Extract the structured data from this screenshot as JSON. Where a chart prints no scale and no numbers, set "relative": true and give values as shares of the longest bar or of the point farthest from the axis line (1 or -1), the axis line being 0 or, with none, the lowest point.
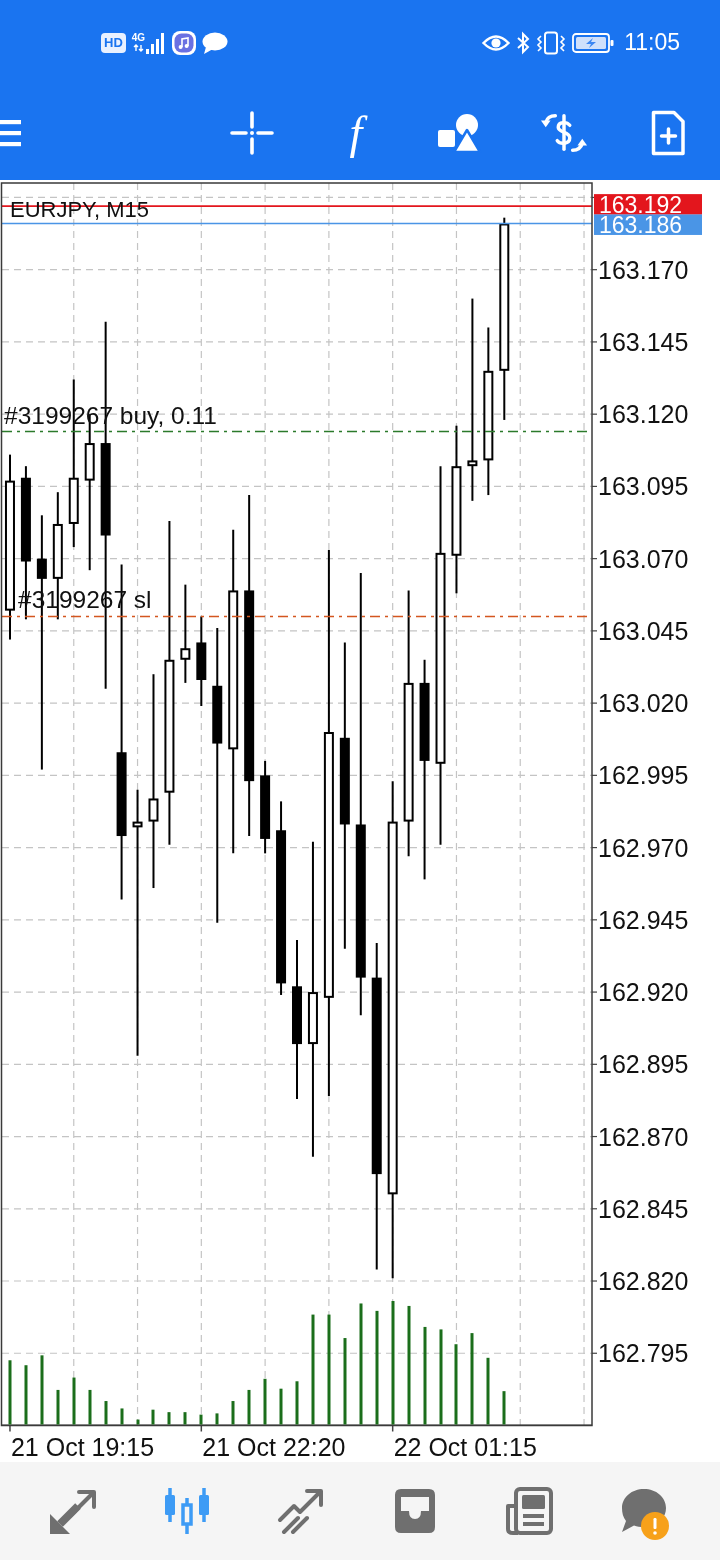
{
  "status_bar": {
    "hd_label": "HD",
    "network_type": "4G",
    "time": "11:05"
  },
  "toolbar": {
    "function_symbol": "f"
  },
  "chart": {
    "chart_data": {
      "type": "candlestick",
      "title": "EURJPY, M15",
      "grid": true,
      "categories": [
        null,
        null,
        null,
        null,
        null,
        null,
        null,
        null,
        null,
        null,
        null,
        null,
        null,
        null,
        null,
        null,
        null,
        null,
        null,
        null,
        null,
        null,
        null,
        null,
        null,
        null,
        null,
        null,
        null,
        null,
        null,
        null,
        null,
        null,
        null,
        null,
        null
      ],
      "ylim": [
        162.77,
        163.2
      ],
      "yticks": [
        {
          "value": 163.17,
          "label": "163.170"
        },
        {
          "value": 163.145,
          "label": "163.145"
        },
        {
          "value": 163.12,
          "label": "163.120"
        },
        {
          "value": 163.095,
          "label": "163.095"
        },
        {
          "value": 163.07,
          "label": "163.070"
        },
        {
          "value": 163.045,
          "label": "163.045"
        },
        {
          "value": 163.02,
          "label": "163.020"
        },
        {
          "value": 162.995,
          "label": "162.995"
        },
        {
          "value": 162.97,
          "label": "162.970"
        },
        {
          "value": 162.945,
          "label": "162.945"
        },
        {
          "value": 162.92,
          "label": "162.920"
        },
        {
          "value": 162.895,
          "label": "162.895"
        },
        {
          "value": 162.87,
          "label": "162.870"
        },
        {
          "value": 162.845,
          "label": "162.845"
        },
        {
          "value": 162.82,
          "label": "162.820"
        },
        {
          "value": 162.795,
          "label": "162.795"
        }
      ],
      "ohlc": [
        [
          163.052,
          163.106,
          163.042,
          163.097
        ],
        [
          163.098,
          163.102,
          163.049,
          163.069
        ],
        [
          163.07,
          163.085,
          162.997,
          163.063
        ],
        [
          163.063,
          163.093,
          163.049,
          163.082
        ],
        [
          163.082,
          163.132,
          163.074,
          163.098
        ],
        [
          163.097,
          163.12,
          163.066,
          163.11
        ],
        [
          163.11,
          163.152,
          163.025,
          163.078
        ],
        [
          163.003,
          163.068,
          162.952,
          162.974
        ],
        [
          162.977,
          162.99,
          162.898,
          162.979
        ],
        [
          162.979,
          163.03,
          162.956,
          162.987
        ],
        [
          162.989,
          163.083,
          162.971,
          163.035
        ],
        [
          163.035,
          163.061,
          163.027,
          163.039
        ],
        [
          163.041,
          163.05,
          163.019,
          163.028
        ],
        [
          163.026,
          163.046,
          162.944,
          163.006
        ],
        [
          163.004,
          163.08,
          162.968,
          163.059
        ],
        [
          163.059,
          163.092,
          162.974,
          162.993
        ],
        [
          162.995,
          163.0,
          162.968,
          162.973
        ],
        [
          162.976,
          162.986,
          162.919,
          162.923
        ],
        [
          162.922,
          162.938,
          162.883,
          162.902
        ],
        [
          162.902,
          162.972,
          162.863,
          162.92
        ],
        [
          162.918,
          163.073,
          162.884,
          163.01
        ],
        [
          163.008,
          163.041,
          162.935,
          162.978
        ],
        [
          162.978,
          163.065,
          162.912,
          162.925
        ],
        [
          162.925,
          162.937,
          162.824,
          162.857
        ],
        [
          162.85,
          162.993,
          162.821,
          162.979
        ],
        [
          162.979,
          163.059,
          162.967,
          163.027
        ],
        [
          163.027,
          163.035,
          162.959,
          163.0
        ],
        [
          162.999,
          163.102,
          162.971,
          163.072
        ],
        [
          163.071,
          163.116,
          163.058,
          163.102
        ],
        [
          163.102,
          163.16,
          163.09,
          163.104
        ],
        [
          163.104,
          163.15,
          163.092,
          163.135
        ],
        [
          163.135,
          163.188,
          163.118,
          163.186
        ],
        null,
        null,
        null,
        null,
        null
      ],
      "ref_lines": [
        {
          "axis": "y",
          "value": 163.192,
          "label": "163.192",
          "color": "#e3161d"
        },
        {
          "axis": "y",
          "value": 163.186,
          "label": "163.186",
          "color": "#4a95e6"
        },
        {
          "axis": "y",
          "value": 163.114,
          "label": "#3199267 buy, 0.11",
          "color": "#2b7a2b"
        },
        {
          "axis": "y",
          "value": 163.05,
          "label": "#3199267 sl",
          "color": "#d4561f"
        }
      ]
    },
    "time_axis_labels": [
      "21 Oct 19:15",
      "21 Oct 22:20",
      "22 Oct 01:15"
    ],
    "volume": {
      "chart_data": {
        "type": "bar",
        "relative": true,
        "categories": [
          null,
          null,
          null,
          null,
          null,
          null,
          null,
          null,
          null,
          null,
          null,
          null,
          null,
          null,
          null,
          null,
          null,
          null,
          null,
          null,
          null,
          null,
          null,
          null,
          null,
          null,
          null,
          null,
          null,
          null,
          null,
          null,
          null,
          null,
          null,
          null,
          null
        ],
        "values": [
          0.52,
          0.48,
          0.56,
          0.28,
          0.38,
          0.28,
          0.19,
          0.13,
          0.04,
          0.12,
          0.1,
          0.1,
          0.08,
          0.09,
          0.19,
          0.28,
          0.37,
          0.29,
          0.35,
          0.89,
          0.89,
          0.7,
          0.98,
          0.92,
          1.0,
          0.96,
          0.79,
          0.77,
          0.65,
          0.74,
          0.54,
          0.27,
          null,
          null,
          null,
          null,
          null
        ]
      }
    }
  },
  "bottom_nav": {
    "items": [
      {
        "selected": false,
        "alert": false
      },
      {
        "selected": true,
        "alert": false
      },
      {
        "selected": false,
        "alert": false
      },
      {
        "selected": false,
        "alert": false
      },
      {
        "selected": false,
        "alert": false
      },
      {
        "selected": false,
        "alert": true
      }
    ]
  }
}
